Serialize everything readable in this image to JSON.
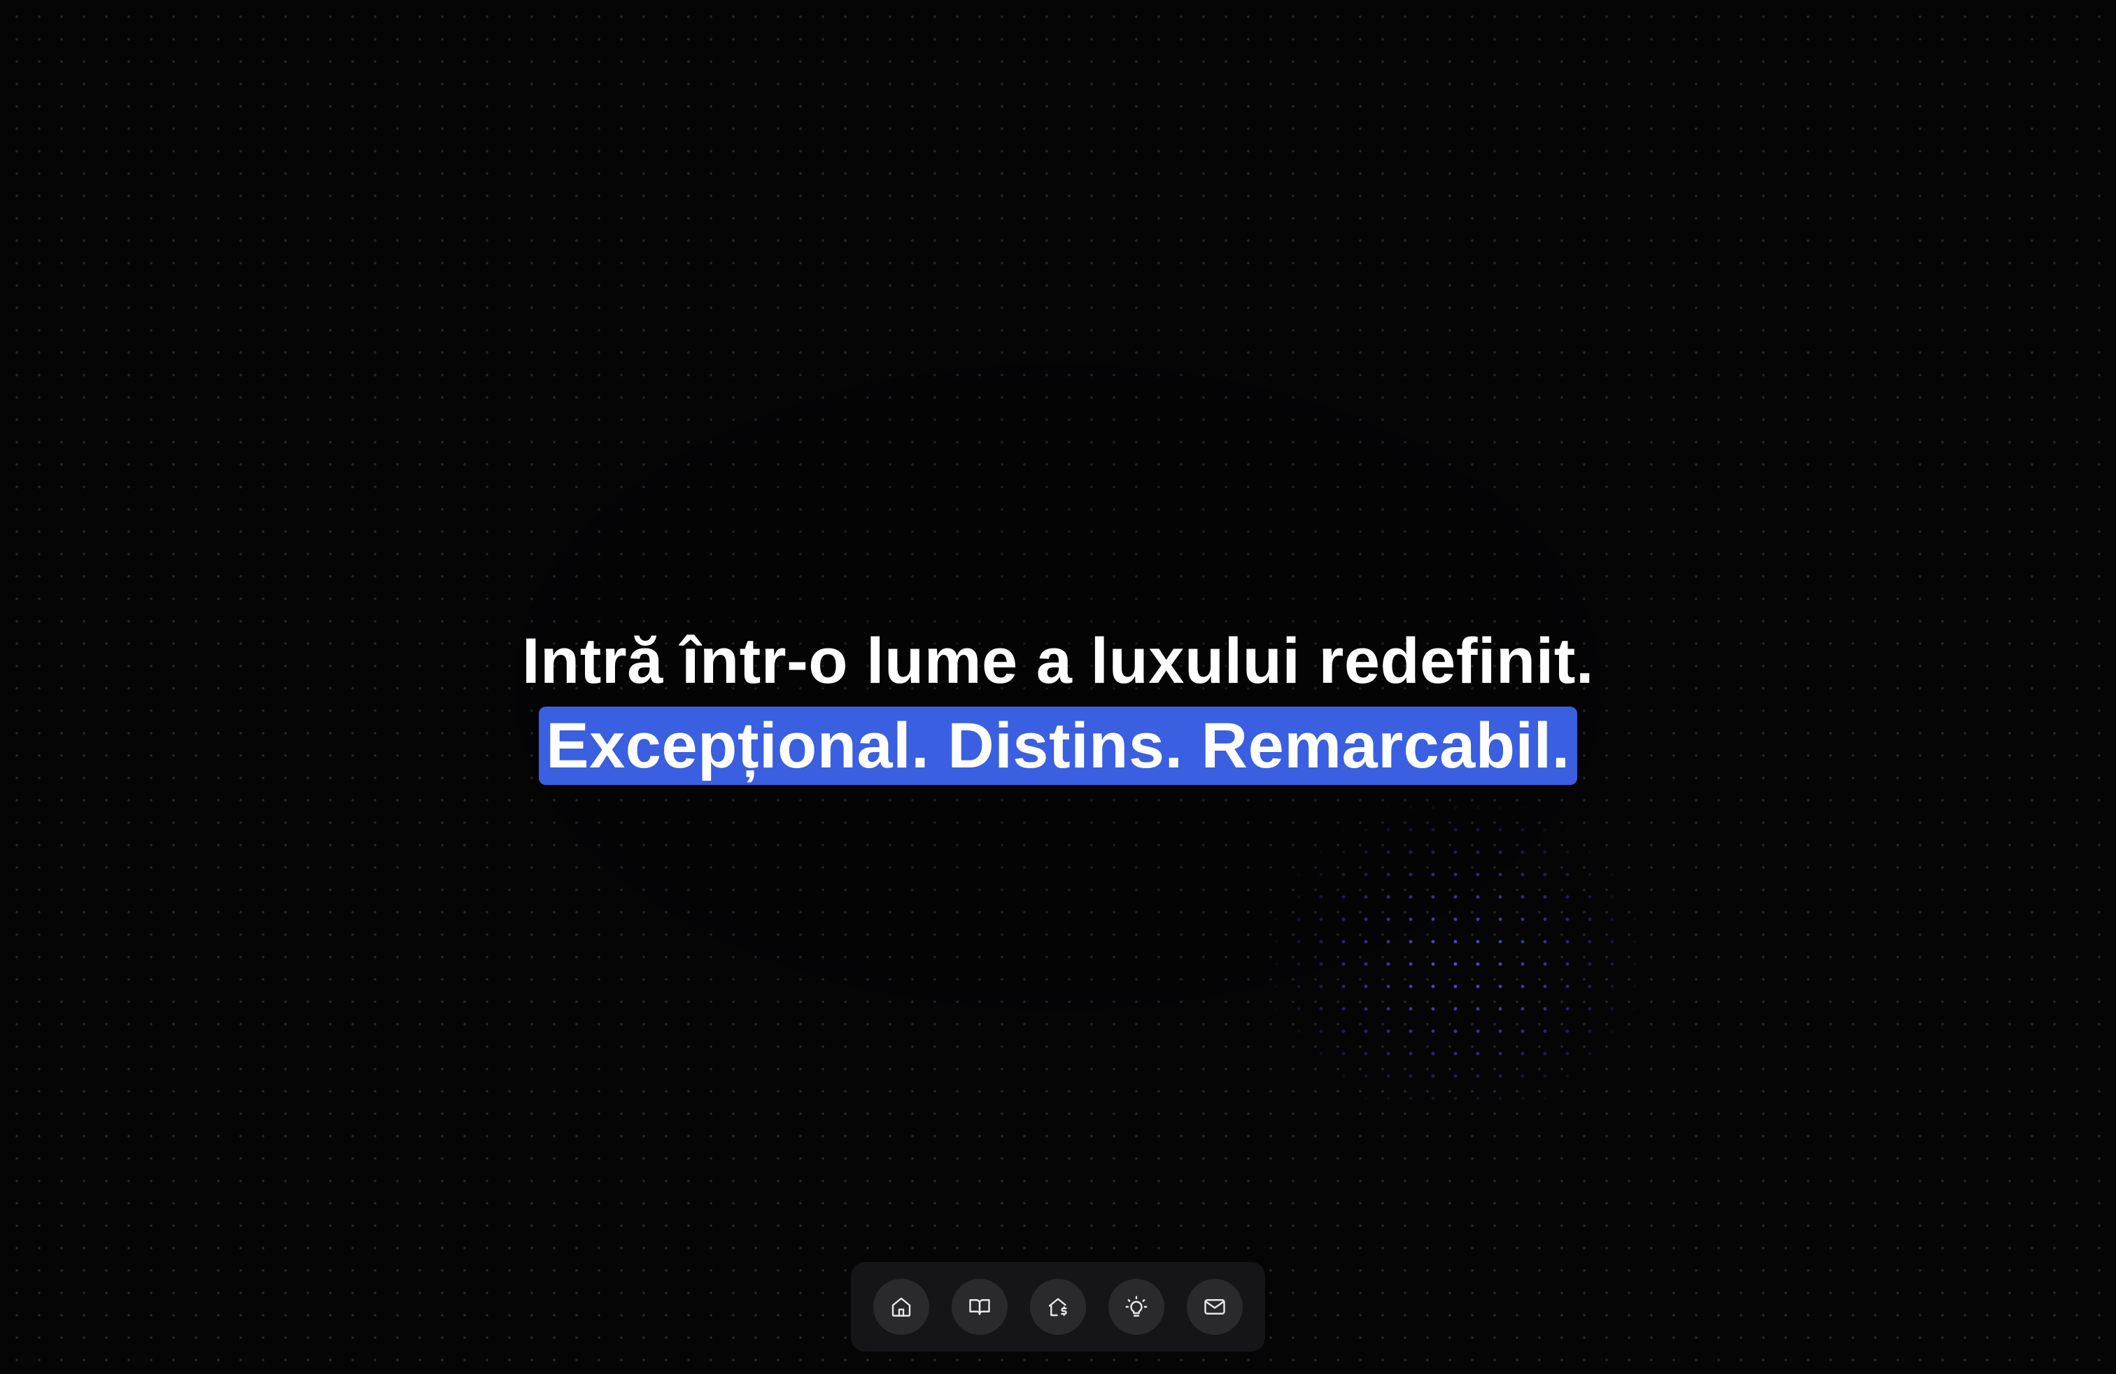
{
  "hero": {
    "headline": "Intră într-o lume a luxului redefinit.",
    "tagline": "Excepțional. Distins. Remarcabil."
  },
  "dock": {
    "items": [
      {
        "icon": "home-icon"
      },
      {
        "icon": "book-icon"
      },
      {
        "icon": "house-price-icon"
      },
      {
        "icon": "lightbulb-icon"
      },
      {
        "icon": "mail-icon"
      }
    ]
  },
  "colors": {
    "background": "#050506",
    "highlight": "#3a5fe0",
    "dot_glow": "#5c60ff",
    "dock_bg": "#151517",
    "dock_button_bg": "#2a2a2e"
  }
}
